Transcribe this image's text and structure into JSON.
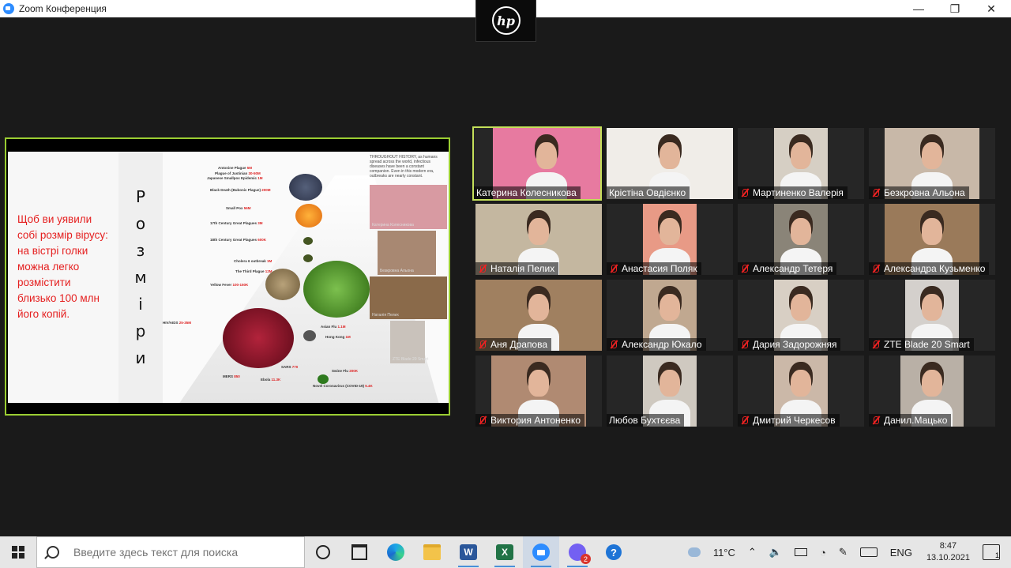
{
  "window": {
    "title": "Zoom Конференция",
    "minimize": "—",
    "maximize": "❐",
    "close": "✕"
  },
  "hp": {
    "logo": "hp"
  },
  "slide": {
    "text": "Щоб ви уявили собі розмір вірусу: на вістрі голки можна легко розмістити близько 100 млн його копій.",
    "side_letters": [
      "Р",
      "о",
      "з",
      "м",
      "і",
      "р",
      "и"
    ],
    "history_note": "THROUGHOUT HISTORY, as humans spread across the world, infectious diseases have been a constant companion. Even in this modern era, outbreaks are nearly constant.",
    "pandemics": [
      {
        "name": "Antonine Plague",
        "deaths": "5M"
      },
      {
        "name": "Plague of Justinian",
        "deaths": "30-50M"
      },
      {
        "name": "Japanese Smallpox Epidemic",
        "deaths": "1M"
      },
      {
        "name": "Black Death (Bubonic Plague)",
        "deaths": "200M"
      },
      {
        "name": "Small Pox",
        "deaths": "56M"
      },
      {
        "name": "17th Century Great Plagues",
        "deaths": "3M"
      },
      {
        "name": "18th Century Great Plagues",
        "deaths": "600K"
      },
      {
        "name": "Cholera 6 outbreak",
        "deaths": "1M"
      },
      {
        "name": "The Third Plague",
        "deaths": "12M"
      },
      {
        "name": "Yellow Fever",
        "deaths": "100-150K"
      },
      {
        "name": "HIV/AIDS",
        "deaths": "25-35M"
      },
      {
        "name": "Asian Flu",
        "deaths": "1.1M"
      },
      {
        "name": "Hong Kong",
        "deaths": "1M"
      },
      {
        "name": "SARS",
        "deaths": "770"
      },
      {
        "name": "Swine Flu",
        "deaths": "200K"
      },
      {
        "name": "MERS",
        "deaths": "850"
      },
      {
        "name": "Ebola",
        "deaths": "11.3K"
      },
      {
        "name": "Novel Coronavirus (COVID-19)",
        "deaths": "5.4K"
      }
    ],
    "mini_captions": [
      "Катерина Колесникова",
      "Безкровна Альона",
      "Наталія Пелих",
      "ZTE Blade 20 Smart"
    ]
  },
  "participants": [
    {
      "name": "Катерина Колесникова",
      "muted": false,
      "active": true
    },
    {
      "name": "Крістіна Овдієнко",
      "muted": false,
      "active": false
    },
    {
      "name": "Мартиненко Валерія",
      "muted": true,
      "active": false
    },
    {
      "name": "Безкровна Альона",
      "muted": true,
      "active": false
    },
    {
      "name": "Наталія Пелих",
      "muted": true,
      "active": false
    },
    {
      "name": "Анастасия Поляк",
      "muted": true,
      "active": false
    },
    {
      "name": "Александр Тетеря",
      "muted": true,
      "active": false
    },
    {
      "name": "Александра Кузьменко",
      "muted": true,
      "active": false
    },
    {
      "name": "Аня Драпова",
      "muted": true,
      "active": false
    },
    {
      "name": "Александр Юкало",
      "muted": true,
      "active": false
    },
    {
      "name": "Дария Задорожняя",
      "muted": true,
      "active": false
    },
    {
      "name": "ZTE Blade 20 Smart",
      "muted": true,
      "active": false
    },
    {
      "name": "Виктория Антоненко",
      "muted": true,
      "active": false
    },
    {
      "name": "Любов Бухтєєва",
      "muted": false,
      "active": false
    },
    {
      "name": "Дмитрий Черкесов",
      "muted": true,
      "active": false
    },
    {
      "name": "Данил.Мацько",
      "muted": true,
      "active": false
    }
  ],
  "taskbar": {
    "search_placeholder": "Введите здесь текст для поиска",
    "word_letter": "W",
    "excel_letter": "X",
    "viber_badge": "2",
    "help_glyph": "?",
    "weather": "11°C",
    "language": "ENG",
    "time": "8:47",
    "date": "13.10.2021",
    "notification_count": "1"
  }
}
